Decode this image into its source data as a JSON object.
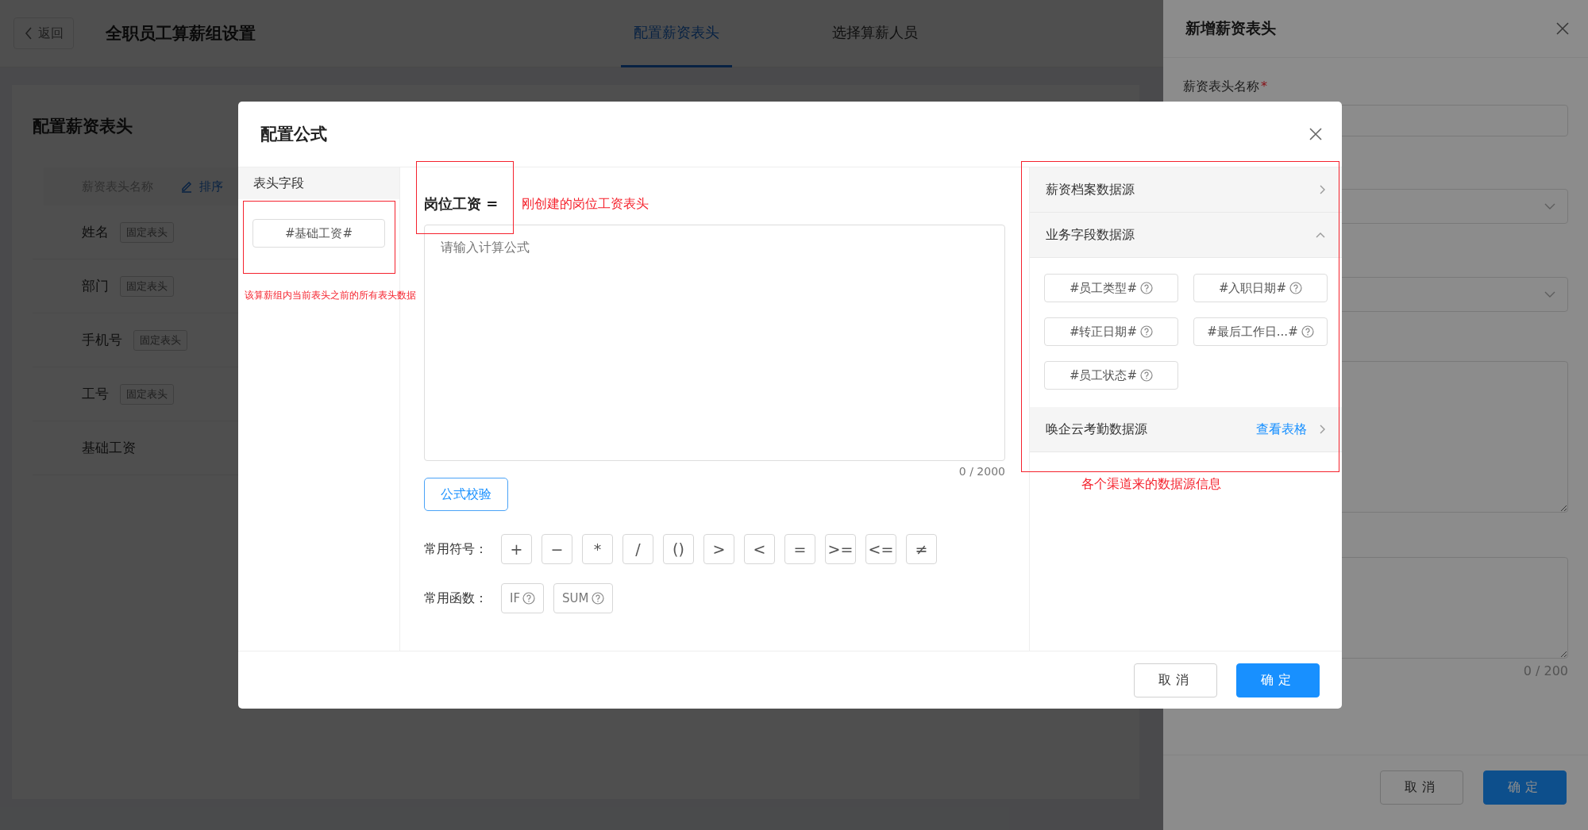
{
  "header": {
    "back": "返回",
    "title": "全职员工算薪组设置",
    "tabs": [
      {
        "label": "配置薪资表头",
        "selected": true
      },
      {
        "label": "选择算薪人员",
        "selected": false
      }
    ]
  },
  "page": {
    "title": "配置薪资表头",
    "columns": [
      "薪资表头名称",
      "排序"
    ],
    "rows": [
      {
        "name": "姓名",
        "tag": "固定表头"
      },
      {
        "name": "部门",
        "tag": "固定表头"
      },
      {
        "name": "手机号",
        "tag": "固定表头"
      },
      {
        "name": "工号",
        "tag": "固定表头"
      },
      {
        "name": "基础工资"
      }
    ]
  },
  "drawer": {
    "title": "新增薪资表头",
    "name_label": "薪资表头名称",
    "required_mark": "*",
    "counter": "0 / 200",
    "buttons": [
      {
        "label": "取消",
        "kind": "default"
      },
      {
        "label": "确定",
        "kind": "primary"
      }
    ]
  },
  "modal": {
    "title": "配置公式",
    "fields_header": "表头字段",
    "fields": [
      "#基础工资#"
    ],
    "formula_label": "岗位工资 =",
    "formula": {
      "placeholder": "请输入计算公式",
      "counter": "0 / 2000"
    },
    "validate_button": "公式校验",
    "symbols_label": "常用符号：",
    "symbols": [
      "+",
      "−",
      "*",
      "/",
      "()",
      ">",
      "<",
      "=",
      ">=",
      "<=",
      "≠"
    ],
    "functions_label": "常用函数：",
    "functions": [
      "IF",
      "SUM"
    ],
    "sources": [
      {
        "title": "薪资档案数据源",
        "expanded": false
      },
      {
        "title": "业务字段数据源",
        "expanded": true,
        "fields": [
          "#员工类型#",
          "#入职日期#",
          "#转正日期#",
          "#最后工作日...#",
          "#员工状态#"
        ]
      },
      {
        "title": "唤企云考勤数据源",
        "expanded": false,
        "link": "查看表格"
      }
    ],
    "buttons": [
      {
        "label": "取消",
        "kind": "default"
      },
      {
        "label": "确定",
        "kind": "primary"
      }
    ],
    "notes": {
      "fields": "该算薪组内当前表头之前的所有表头数据",
      "formula": "刚创建的岗位工资表头",
      "sources": "各个渠道来的数据源信息"
    }
  }
}
